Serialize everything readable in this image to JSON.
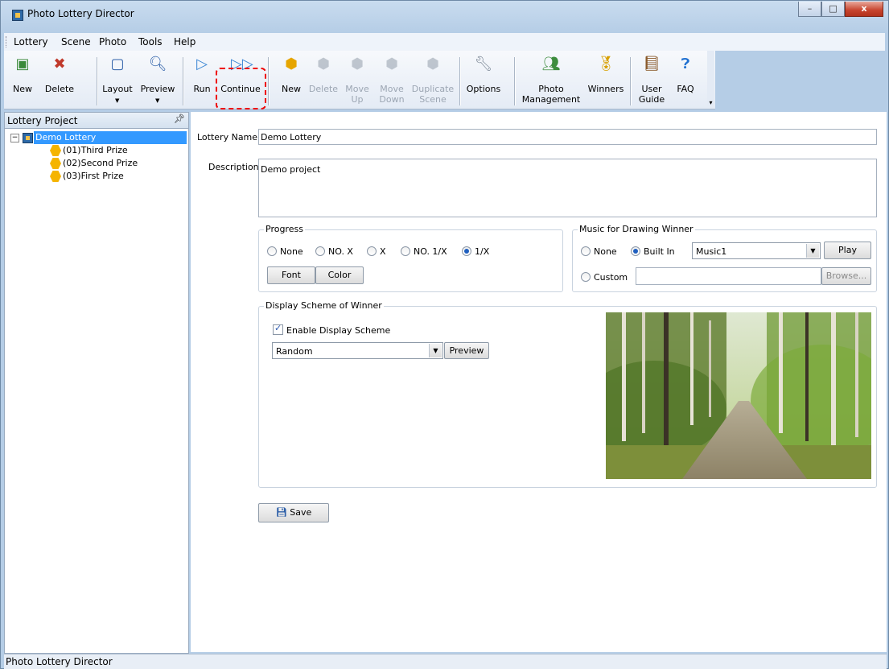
{
  "window": {
    "title": "Photo Lottery Director",
    "controls": {
      "minimize": "–",
      "maximize": "□",
      "close": "x"
    }
  },
  "menu": [
    "Lottery",
    "Scene",
    "Photo",
    "Tools",
    "Help"
  ],
  "toolbar": {
    "new": "New",
    "delete": "Delete",
    "layout": "Layout",
    "preview": "Preview",
    "run": "Run",
    "continue": "Continue",
    "scene_new": "New",
    "scene_delete": "Delete",
    "move_up": "Move\nUp",
    "move_down": "Move\nDown",
    "duplicate": "Duplicate\nScene",
    "options": "Options",
    "photo_management": "Photo\nManagement",
    "winners": "Winners",
    "user_guide": "User\nGuide",
    "faq": "FAQ"
  },
  "left_panel": {
    "title": "Lottery Project",
    "root": "Demo Lottery",
    "scenes": [
      "(01)Third Prize",
      "(02)Second Prize",
      "(03)First Prize"
    ]
  },
  "form": {
    "name_label": "Lottery Name",
    "name_value": "Demo Lottery",
    "desc_label": "Description",
    "desc_value": "Demo project"
  },
  "progress": {
    "title": "Progress",
    "options": [
      "None",
      "NO. X",
      "X",
      "NO. 1/X",
      "1/X"
    ],
    "selected": "1/X",
    "font_button": "Font",
    "color_button": "Color"
  },
  "music": {
    "title": "Music for Drawing Winner",
    "none": "None",
    "built_in": "Built In",
    "custom": "Custom",
    "selected": "Built In",
    "track": "Music1",
    "play_button": "Play",
    "browse_button": "Browse..."
  },
  "display_scheme": {
    "title": "Display Scheme of Winner",
    "enable_label": "Enable Display Scheme",
    "enabled": true,
    "scheme": "Random",
    "preview_button": "Preview"
  },
  "save_button": "Save",
  "status": "Photo Lottery Director",
  "colors": {
    "selection": "#3399ff",
    "highlight": "#e00000",
    "hex_icon": "#f5b400",
    "title_bg": "#b5cde6"
  }
}
